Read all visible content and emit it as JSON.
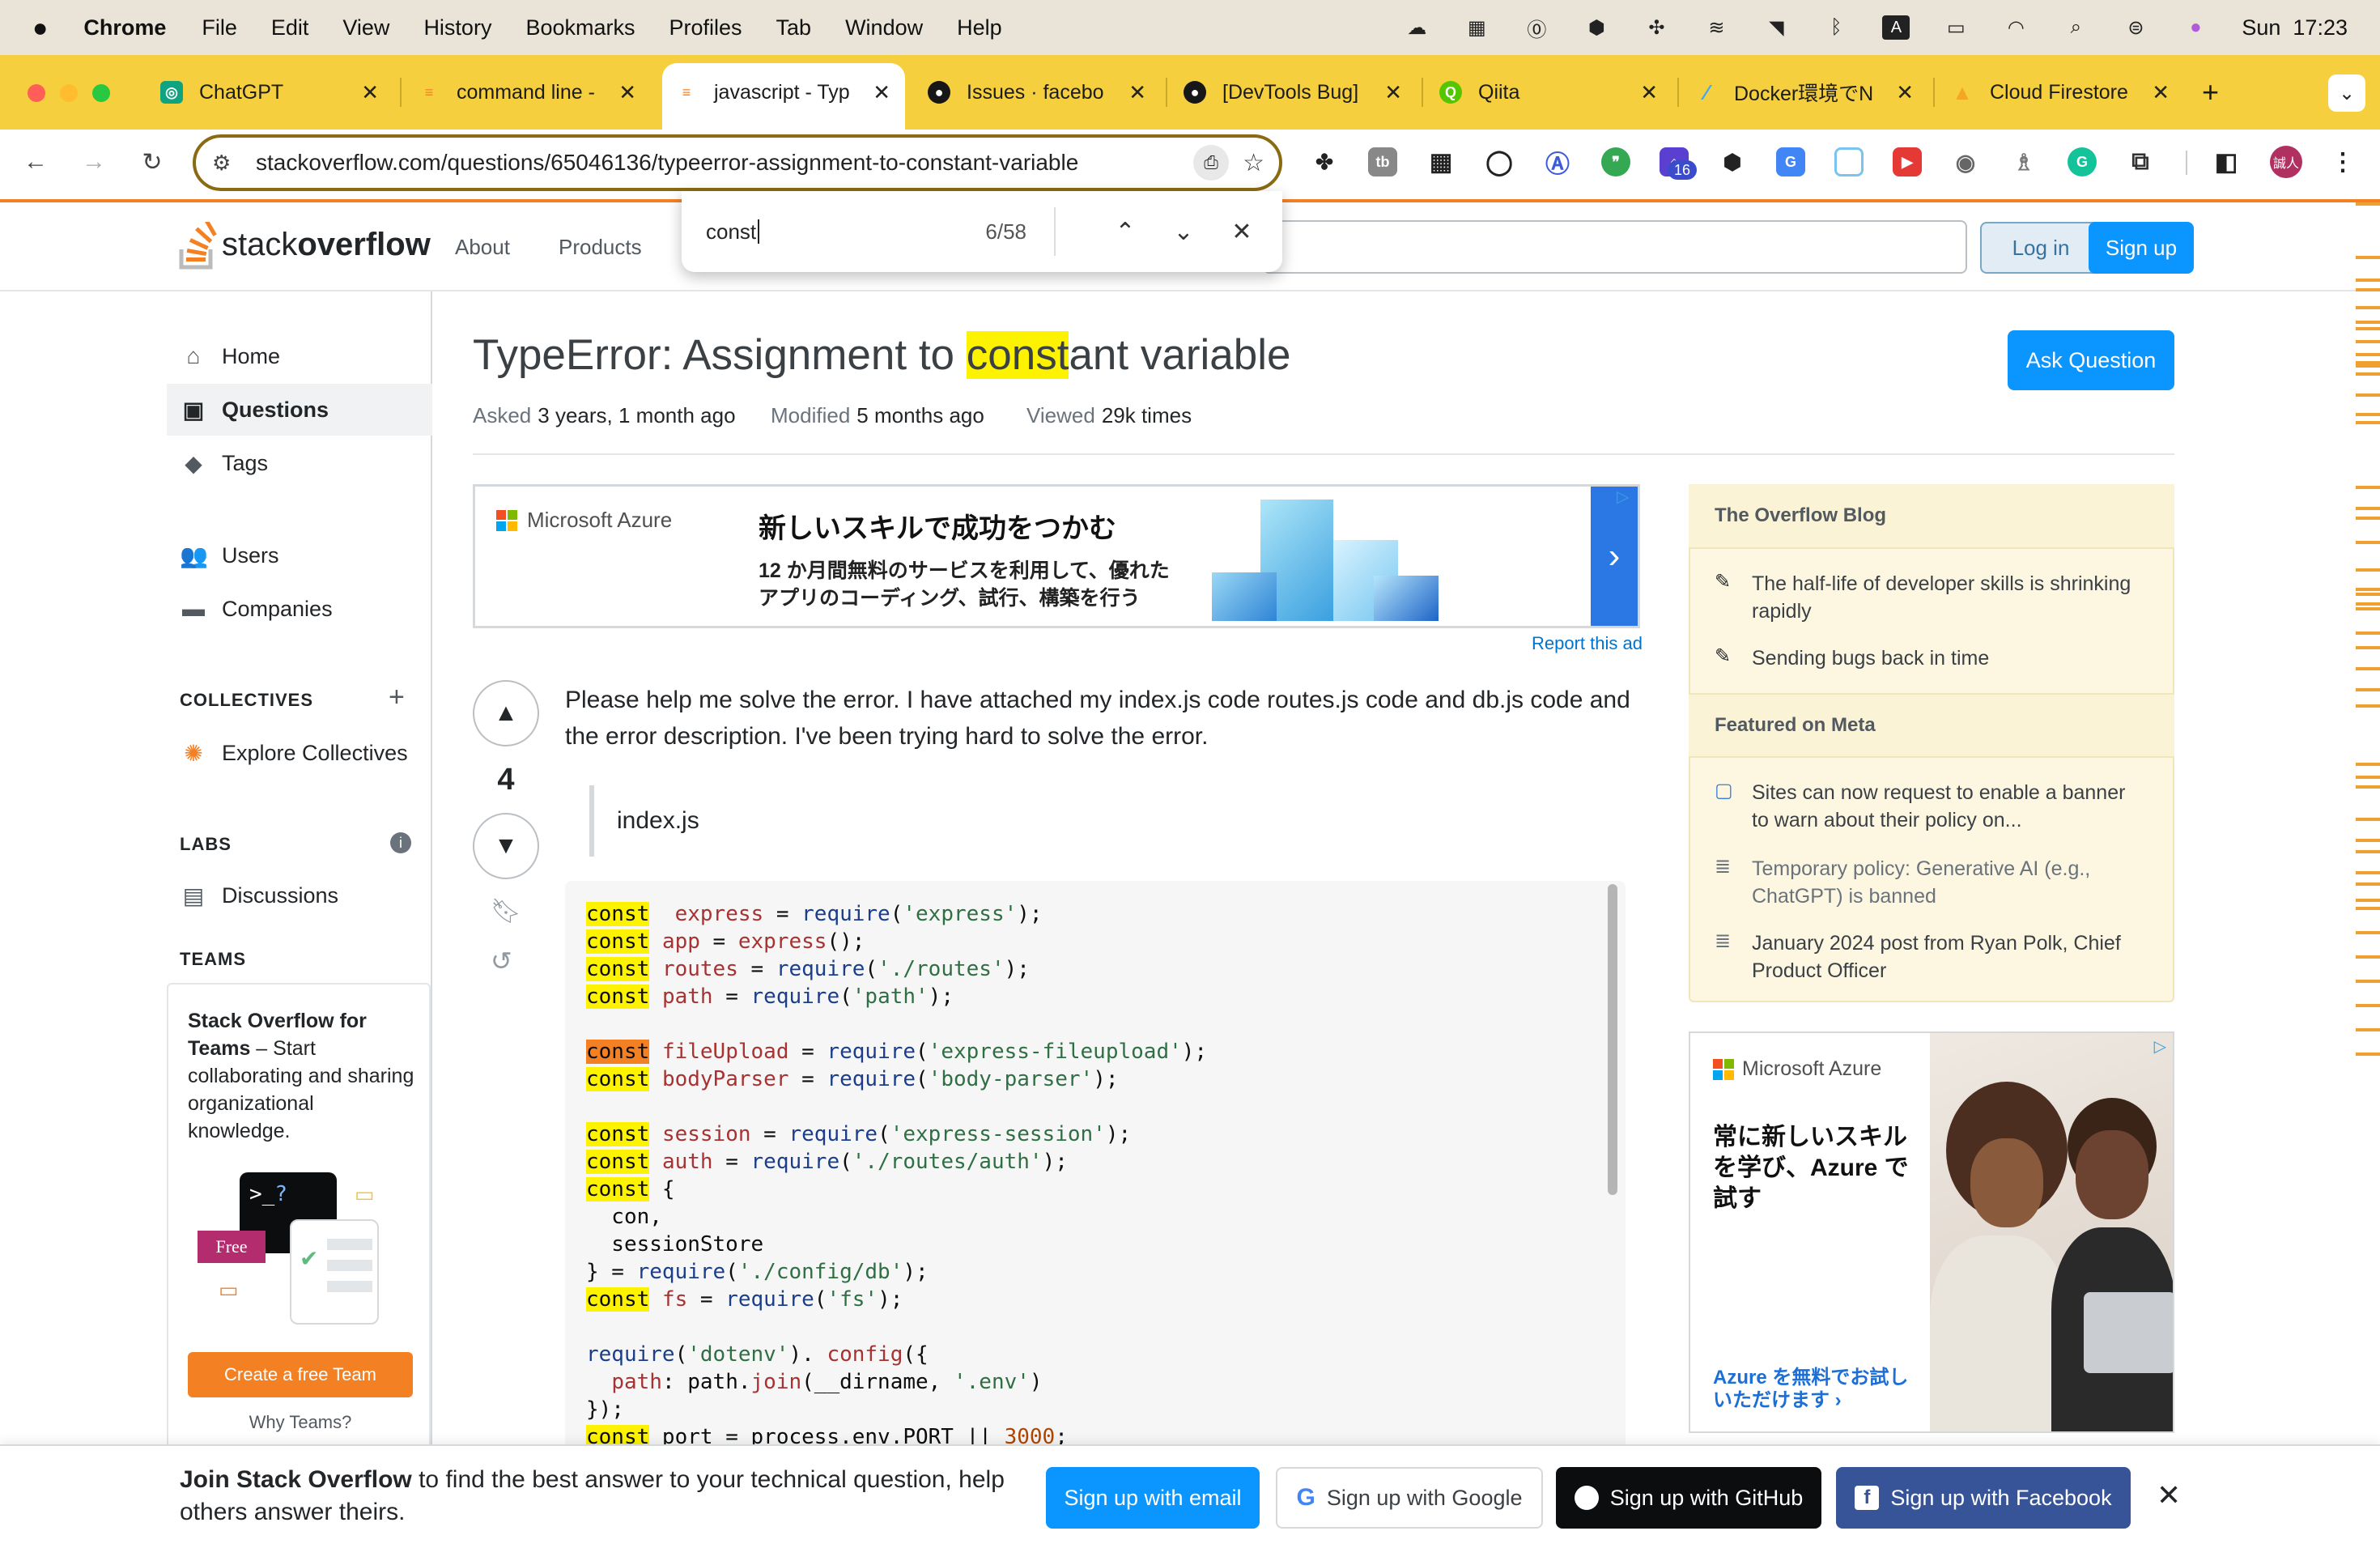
{
  "menubar": {
    "app": "Chrome",
    "items": [
      "File",
      "Edit",
      "View",
      "History",
      "Bookmarks",
      "Profiles",
      "Tab",
      "Window",
      "Help"
    ],
    "clock": "Sun  17:23"
  },
  "tabs": [
    {
      "title": "ChatGPT",
      "icon": "chatgpt-icon",
      "color": "#10a37f"
    },
    {
      "title": "command line -",
      "icon": "stackoverflow-icon",
      "color": "#f48024"
    },
    {
      "title": "javascript - Typ",
      "icon": "stackoverflow-icon",
      "color": "#f48024",
      "active": true
    },
    {
      "title": "Issues · facebo",
      "icon": "github-icon",
      "color": "#181717"
    },
    {
      "title": "[DevTools Bug]",
      "icon": "github-icon",
      "color": "#181717"
    },
    {
      "title": "Qiita",
      "icon": "qiita-icon",
      "color": "#55c500"
    },
    {
      "title": "Docker環境でN",
      "icon": "zenn-icon",
      "color": "#3ea8ff"
    },
    {
      "title": "Cloud Firestore",
      "icon": "firebase-icon",
      "color": "#ffca28"
    }
  ],
  "omnibox": {
    "url": "stackoverflow.com/questions/65046136/typeerror-assignment-to-constant-variable"
  },
  "extensions": {
    "badge": "16",
    "avatar": "誠人"
  },
  "findbar": {
    "query": "const",
    "count": "6/58"
  },
  "so_header": {
    "logo_a": "stack",
    "logo_b": "overflow",
    "nav": [
      "About",
      "Products"
    ],
    "login": "Log in",
    "signup": "Sign up"
  },
  "leftnav": {
    "home": "Home",
    "questions": "Questions",
    "tags": "Tags",
    "users": "Users",
    "companies": "Companies",
    "collectives_head": "COLLECTIVES",
    "explore": "Explore Collectives",
    "labs_head": "LABS",
    "discussions": "Discussions",
    "teams_head": "TEAMS",
    "teams_title": "Stack Overflow for Teams",
    "teams_desc": " – Start collaborating and sharing organizational knowledge.",
    "free_badge": "Free",
    "create_team": "Create a free Team",
    "why_teams": "Why Teams?"
  },
  "question": {
    "title_pre": "TypeError: Assignment to ",
    "title_hl": "const",
    "title_post": "ant variable",
    "asked_label": "Asked",
    "asked": "3 years, 1 month ago",
    "modified_label": "Modified",
    "modified": "5 months ago",
    "viewed_label": "Viewed",
    "viewed": "29k times",
    "ask_button": "Ask Question",
    "score": "4",
    "body": "Please help me solve the error. I have attached my index.js code routes.js code and db.js code and the error description. I've been trying hard to solve the error.",
    "blockquote": "index.js"
  },
  "ad_top": {
    "brand": "Microsoft Azure",
    "headline": "新しいスキルで成功をつかむ",
    "sub1": "12 か月間無料のサービスを利用して、優れた",
    "sub2": "アプリのコーディング、試行、構築を行う",
    "report": "Report this ad"
  },
  "code_lines": [
    [
      [
        "kw",
        "const"
      ],
      [
        "",
        "  "
      ],
      [
        "cl",
        "express"
      ],
      [
        "",
        " = "
      ],
      [
        "fn",
        "require"
      ],
      [
        "",
        "("
      ],
      [
        "st",
        "'express'"
      ],
      [
        "",
        ");"
      ]
    ],
    [
      [
        "kw",
        "const"
      ],
      [
        "",
        " "
      ],
      [
        "cl",
        "app"
      ],
      [
        "",
        " = "
      ],
      [
        "cl",
        "express"
      ],
      [
        "",
        "();"
      ]
    ],
    [
      [
        "kw",
        "const"
      ],
      [
        "",
        " "
      ],
      [
        "cl",
        "routes"
      ],
      [
        "",
        " = "
      ],
      [
        "fn",
        "require"
      ],
      [
        "",
        "("
      ],
      [
        "st",
        "'./routes'"
      ],
      [
        "",
        ");"
      ]
    ],
    [
      [
        "kw",
        "const"
      ],
      [
        "",
        " "
      ],
      [
        "cl",
        "path"
      ],
      [
        "",
        " = "
      ],
      [
        "fn",
        "require"
      ],
      [
        "",
        "("
      ],
      [
        "st",
        "'path'"
      ],
      [
        "",
        ");"
      ]
    ],
    [
      [
        "",
        ""
      ]
    ],
    [
      [
        "kwa",
        "const"
      ],
      [
        "",
        " "
      ],
      [
        "cl",
        "fileUpload"
      ],
      [
        "",
        " = "
      ],
      [
        "fn",
        "require"
      ],
      [
        "",
        "("
      ],
      [
        "st",
        "'express-fileupload'"
      ],
      [
        "",
        ");"
      ]
    ],
    [
      [
        "kw",
        "const"
      ],
      [
        "",
        " "
      ],
      [
        "cl",
        "bodyParser"
      ],
      [
        "",
        " = "
      ],
      [
        "fn",
        "require"
      ],
      [
        "",
        "("
      ],
      [
        "st",
        "'body-parser'"
      ],
      [
        "",
        ");"
      ]
    ],
    [
      [
        "",
        ""
      ]
    ],
    [
      [
        "kw",
        "const"
      ],
      [
        "",
        " "
      ],
      [
        "cl",
        "session"
      ],
      [
        "",
        " = "
      ],
      [
        "fn",
        "require"
      ],
      [
        "",
        "("
      ],
      [
        "st",
        "'express-session'"
      ],
      [
        "",
        ");"
      ]
    ],
    [
      [
        "kw",
        "const"
      ],
      [
        "",
        " "
      ],
      [
        "cl",
        "auth"
      ],
      [
        "",
        " = "
      ],
      [
        "fn",
        "require"
      ],
      [
        "",
        "("
      ],
      [
        "st",
        "'./routes/auth'"
      ],
      [
        "",
        ");"
      ]
    ],
    [
      [
        "kw",
        "const"
      ],
      [
        "",
        " {"
      ]
    ],
    [
      [
        "",
        "  con,"
      ]
    ],
    [
      [
        "",
        "  sessionStore"
      ]
    ],
    [
      [
        "",
        "} = "
      ],
      [
        "fn",
        "require"
      ],
      [
        "",
        "("
      ],
      [
        "st",
        "'./config/db'"
      ],
      [
        "",
        ");"
      ]
    ],
    [
      [
        "kw",
        "const"
      ],
      [
        "",
        " "
      ],
      [
        "cl",
        "fs"
      ],
      [
        "",
        " = "
      ],
      [
        "fn",
        "require"
      ],
      [
        "",
        "("
      ],
      [
        "st",
        "'fs'"
      ],
      [
        "",
        ");"
      ]
    ],
    [
      [
        "",
        ""
      ]
    ],
    [
      [
        "fn",
        "require"
      ],
      [
        "",
        "("
      ],
      [
        "st",
        "'dotenv'"
      ],
      [
        "",
        "). "
      ],
      [
        "cl",
        "config"
      ],
      [
        "",
        "({"
      ]
    ],
    [
      [
        "",
        "  "
      ],
      [
        "cl",
        "path"
      ],
      [
        "",
        ": path."
      ],
      [
        "cl",
        "join"
      ],
      [
        "",
        "(__dirname, "
      ],
      [
        "st",
        "'.env'"
      ],
      [
        "",
        ")"
      ]
    ],
    [
      [
        "",
        "});"
      ]
    ],
    [
      [
        "kw",
        "const"
      ],
      [
        "",
        " port = process.env.PORT || "
      ],
      [
        "nm",
        "3000"
      ],
      [
        "",
        ";"
      ]
    ]
  ],
  "sidebar": {
    "blog_head": "The Overflow Blog",
    "blog1": "The half-life of developer skills is shrinking rapidly",
    "blog2": "Sending bugs back in time",
    "meta_head": "Featured on Meta",
    "meta1": "Sites can now request to enable a banner to warn about their policy on...",
    "meta2": "Temporary policy: Generative AI (e.g., ChatGPT) is banned",
    "meta3": "January 2024 post from Ryan Polk, Chief Product Officer"
  },
  "ad_side": {
    "brand": "Microsoft Azure",
    "headline": "常に新しいスキルを学び、Azure で 試す",
    "cta": "Azure を無料でお試しいただけます ›"
  },
  "banner": {
    "bold": "Join Stack Overflow",
    "text": " to find the best answer to your technical question, help others answer theirs.",
    "email": "Sign up with email",
    "google": "Sign up with Google",
    "github": "Sign up with GitHub",
    "facebook": "Sign up with Facebook"
  }
}
